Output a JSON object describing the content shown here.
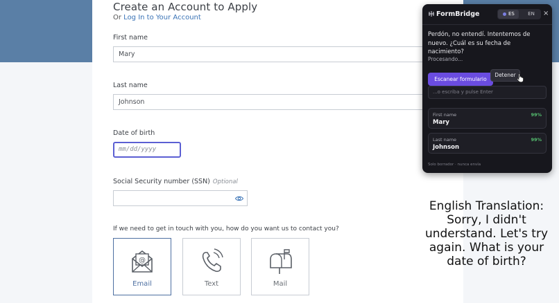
{
  "form": {
    "title": "Create an Account to Apply",
    "login_prefix": "Or ",
    "login_link": "Log In to Your Account",
    "first_name": {
      "label": "First name",
      "value": "Mary"
    },
    "last_name": {
      "label": "Last name",
      "value": "Johnson"
    },
    "dob": {
      "label": "Date of birth",
      "placeholder": "mm/dd/yyyy"
    },
    "ssn": {
      "label": "Social Security number (SSN)",
      "optional": "Optional"
    },
    "contact": {
      "question": "If we need to get in touch with you, how do you want us to contact you?",
      "options": [
        {
          "label": "Email",
          "icon": "email-icon",
          "selected": true
        },
        {
          "label": "Text",
          "icon": "phone-icon",
          "selected": false
        },
        {
          "label": "Mail",
          "icon": "mailbox-icon",
          "selected": false
        }
      ]
    }
  },
  "formbridge": {
    "title": "FormBridge",
    "lang_es": "ES",
    "lang_en": "EN",
    "close": "×",
    "message": "Perdón, no entendí. Intentemos de nuevo. ¿Cuál es su fecha de nacimiento?",
    "status": "Procesando...",
    "scan_button": "Escanear formulario",
    "stop_button": "Detener",
    "input_placeholder": "...o escriba y pulse Enter",
    "fields": [
      {
        "label": "First name",
        "value": "Mary",
        "confidence": "99%"
      },
      {
        "label": "Last name",
        "value": "Johnson",
        "confidence": "99%"
      }
    ],
    "footer": "Solo borrador · nunca envía"
  },
  "translation": {
    "text": "English Translation: Sorry, I didn't understand. Let's try again. What is your date of birth?"
  },
  "colors": {
    "accent": "#5b5fd3",
    "header_band": "#5a7fa6",
    "panel_bg": "#17171d",
    "scan_button": "#6a4ce0",
    "confidence": "#56c271"
  }
}
